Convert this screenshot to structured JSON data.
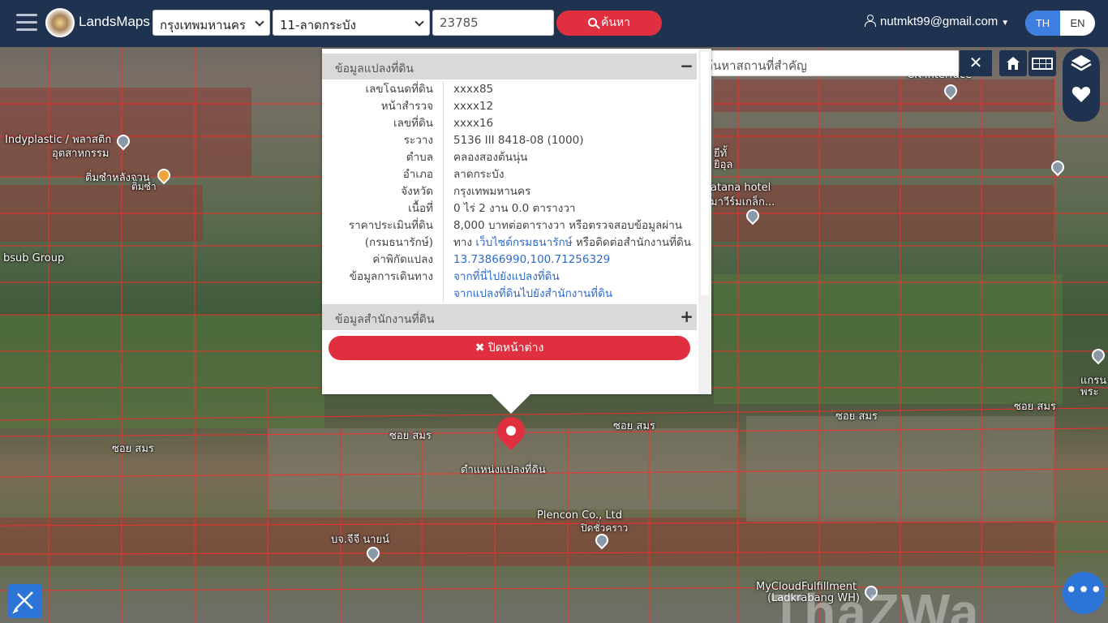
{
  "header": {
    "brand": "LandsMaps",
    "province_select": "กรุงเทพมหานคร",
    "district_select": "11-ลาดกระบัง",
    "parcel_input": "23785",
    "search_label": "ค้นหา",
    "user_email": "nutmkt99@gmail.com",
    "lang_th": "TH",
    "lang_en": "EN"
  },
  "place_search": {
    "placeholder": "ค้นหาสถานที่สำคัญ",
    "clear": "✕"
  },
  "popup": {
    "section1_title": "ข้อมูลแปลงที่ดิน",
    "section1_toggle": "−",
    "rows": [
      {
        "k": "เลขโฉนดที่ดิน",
        "v": "xxxx85"
      },
      {
        "k": "หน้าสำรวจ",
        "v": "xxxx12"
      },
      {
        "k": "เลขที่ดิน",
        "v": "xxxx16"
      },
      {
        "k": "ระวาง",
        "v": "5136 III 8418-08 (1000)"
      },
      {
        "k": "ตำบล",
        "v": "คลองสองต้นนุ่น"
      },
      {
        "k": "อำเภอ",
        "v": "ลาดกระบัง"
      },
      {
        "k": "จังหวัด",
        "v": "กรุงเทพมหานคร"
      },
      {
        "k": "เนื้อที่",
        "v": "0 ไร่ 2 งาน 0.0 ตารางวา"
      },
      {
        "k": "ราคาประเมินที่ดิน",
        "v": "8,000 บาทต่อตารางวา หรือตรวจสอบข้อมูลผ่าน"
      },
      {
        "k": "(กรมธนารักษ์)",
        "v_pre": "ทาง ",
        "v_link": "เว็บไซต์กรมธนารักษ์",
        "v_post": " หรือติดต่อสำนักงานที่ดิน"
      },
      {
        "k": "ค่าพิกัดแปลง",
        "v_link": "13.73866990,100.71256329"
      },
      {
        "k": "ข้อมูลการเดินทาง",
        "v_link": "จากที่นี่ไปยังแปลงที่ดิน"
      },
      {
        "k": "",
        "v_link": "จากแปลงที่ดินไปยังสำนักงานที่ดิน"
      }
    ],
    "section2_title": "ข้อมูลสำนักงานที่ดิน",
    "section2_toggle": "+",
    "close_label": "✖ ปิดหน้าต่าง"
  },
  "map": {
    "labels": {
      "indyplastic": "Indyplastic / พลาสติก",
      "industry": "อุตสาหกรรม",
      "dimsum": "ติ่มซำหลังจวน",
      "dimsum2": "ติ่มซำ",
      "bsub": "bsub Group",
      "soi1": "ซอย สมร",
      "soi2": "ซอย สมร",
      "soi3": "ซอย สมร",
      "soi4": "ซอย สมร",
      "soi5": "ซอย สมร",
      "parcel_position": "ตำแหน่งแปลงที่ดิน",
      "plencon": "Plencon Co., Ltd",
      "pidchawa": "ปิดชั่วคราว",
      "bjj": "บจ.จีจี นายน์",
      "mycloud": "MyCloudFulfillment",
      "mycloud2": "(Ladkrabang WH)",
      "atana": "atana hotel",
      "atana2": "มาวีร์มเกล็ก...",
      "ck": "CK Interface",
      "yi": "ยีทั้",
      "yi2": "ยิอุล",
      "pra": "แกรน",
      "pra2": "พระ"
    },
    "watermark": "ThaZWa"
  },
  "colors": {
    "header_bg": "#1f3350",
    "accent_red": "#e0303f",
    "accent_blue": "#3d7ee0"
  },
  "icons": {
    "menu": "hamburger-icon",
    "search": "search-icon",
    "user": "user-icon",
    "home": "home-icon",
    "grid": "grid-icon",
    "layers": "layers-icon",
    "heart": "heart-icon",
    "ruler": "ruler-pencil-icon",
    "chat": "chat-icon",
    "marker": "location-marker-icon"
  }
}
